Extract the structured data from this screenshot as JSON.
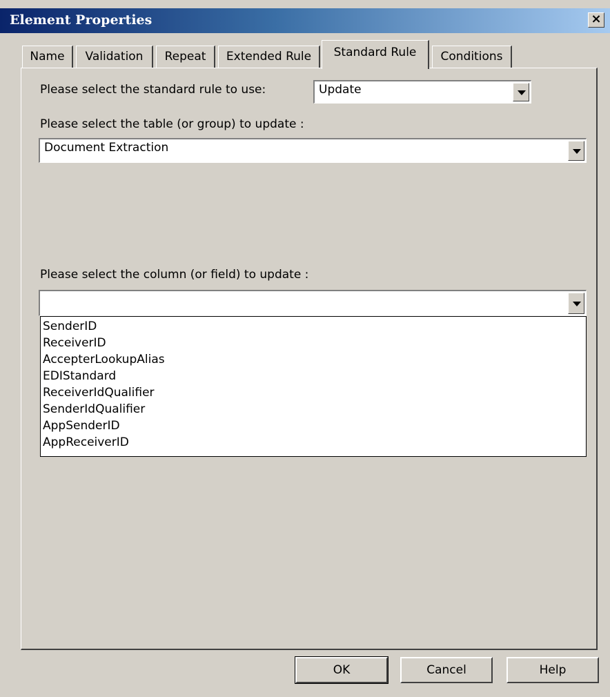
{
  "window": {
    "title": "Element Properties",
    "close_glyph": "×"
  },
  "tabs": [
    {
      "label": "Name"
    },
    {
      "label": "Validation"
    },
    {
      "label": "Repeat"
    },
    {
      "label": "Extended Rule"
    },
    {
      "label": "Standard Rule"
    },
    {
      "label": "Conditions"
    }
  ],
  "active_tab": "Standard Rule",
  "standard_rule": {
    "rule_label": "Please select the standard rule to use:",
    "rule_value": "Update",
    "table_label": "Please select the table (or group) to update :",
    "table_value": "Document Extraction",
    "column_label": "Please select the column (or field) to update :",
    "column_value": "",
    "column_options": [
      "SenderID",
      "ReceiverID",
      "AccepterLookupAlias",
      "EDIStandard",
      "ReceiverIdQualifier",
      "SenderIdQualifier",
      "AppSenderID",
      "AppReceiverID"
    ]
  },
  "buttons": {
    "ok": "OK",
    "cancel": "Cancel",
    "help": "Help"
  },
  "colors": {
    "dialog_bg": "#d4d0c8",
    "title_gradient_start": "#0a246a",
    "title_gradient_end": "#a6caf0"
  }
}
